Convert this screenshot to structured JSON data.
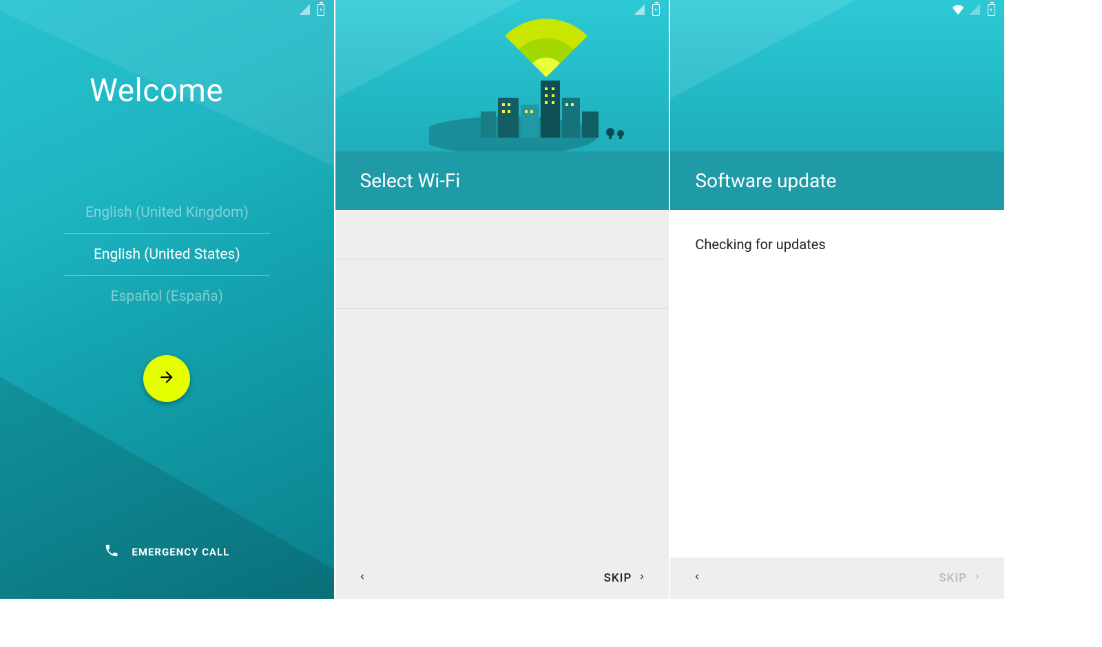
{
  "panel1": {
    "title": "Welcome",
    "languages": {
      "prev": "English (United Kingdom)",
      "selected": "English (United States)",
      "next": "Español (España)"
    },
    "emergency_label": "EMERGENCY CALL"
  },
  "panel2": {
    "title": "Select Wi-Fi",
    "skip_label": "SKIP"
  },
  "panel3": {
    "title": "Software update",
    "message": "Checking for updates",
    "skip_label": "SKIP"
  }
}
